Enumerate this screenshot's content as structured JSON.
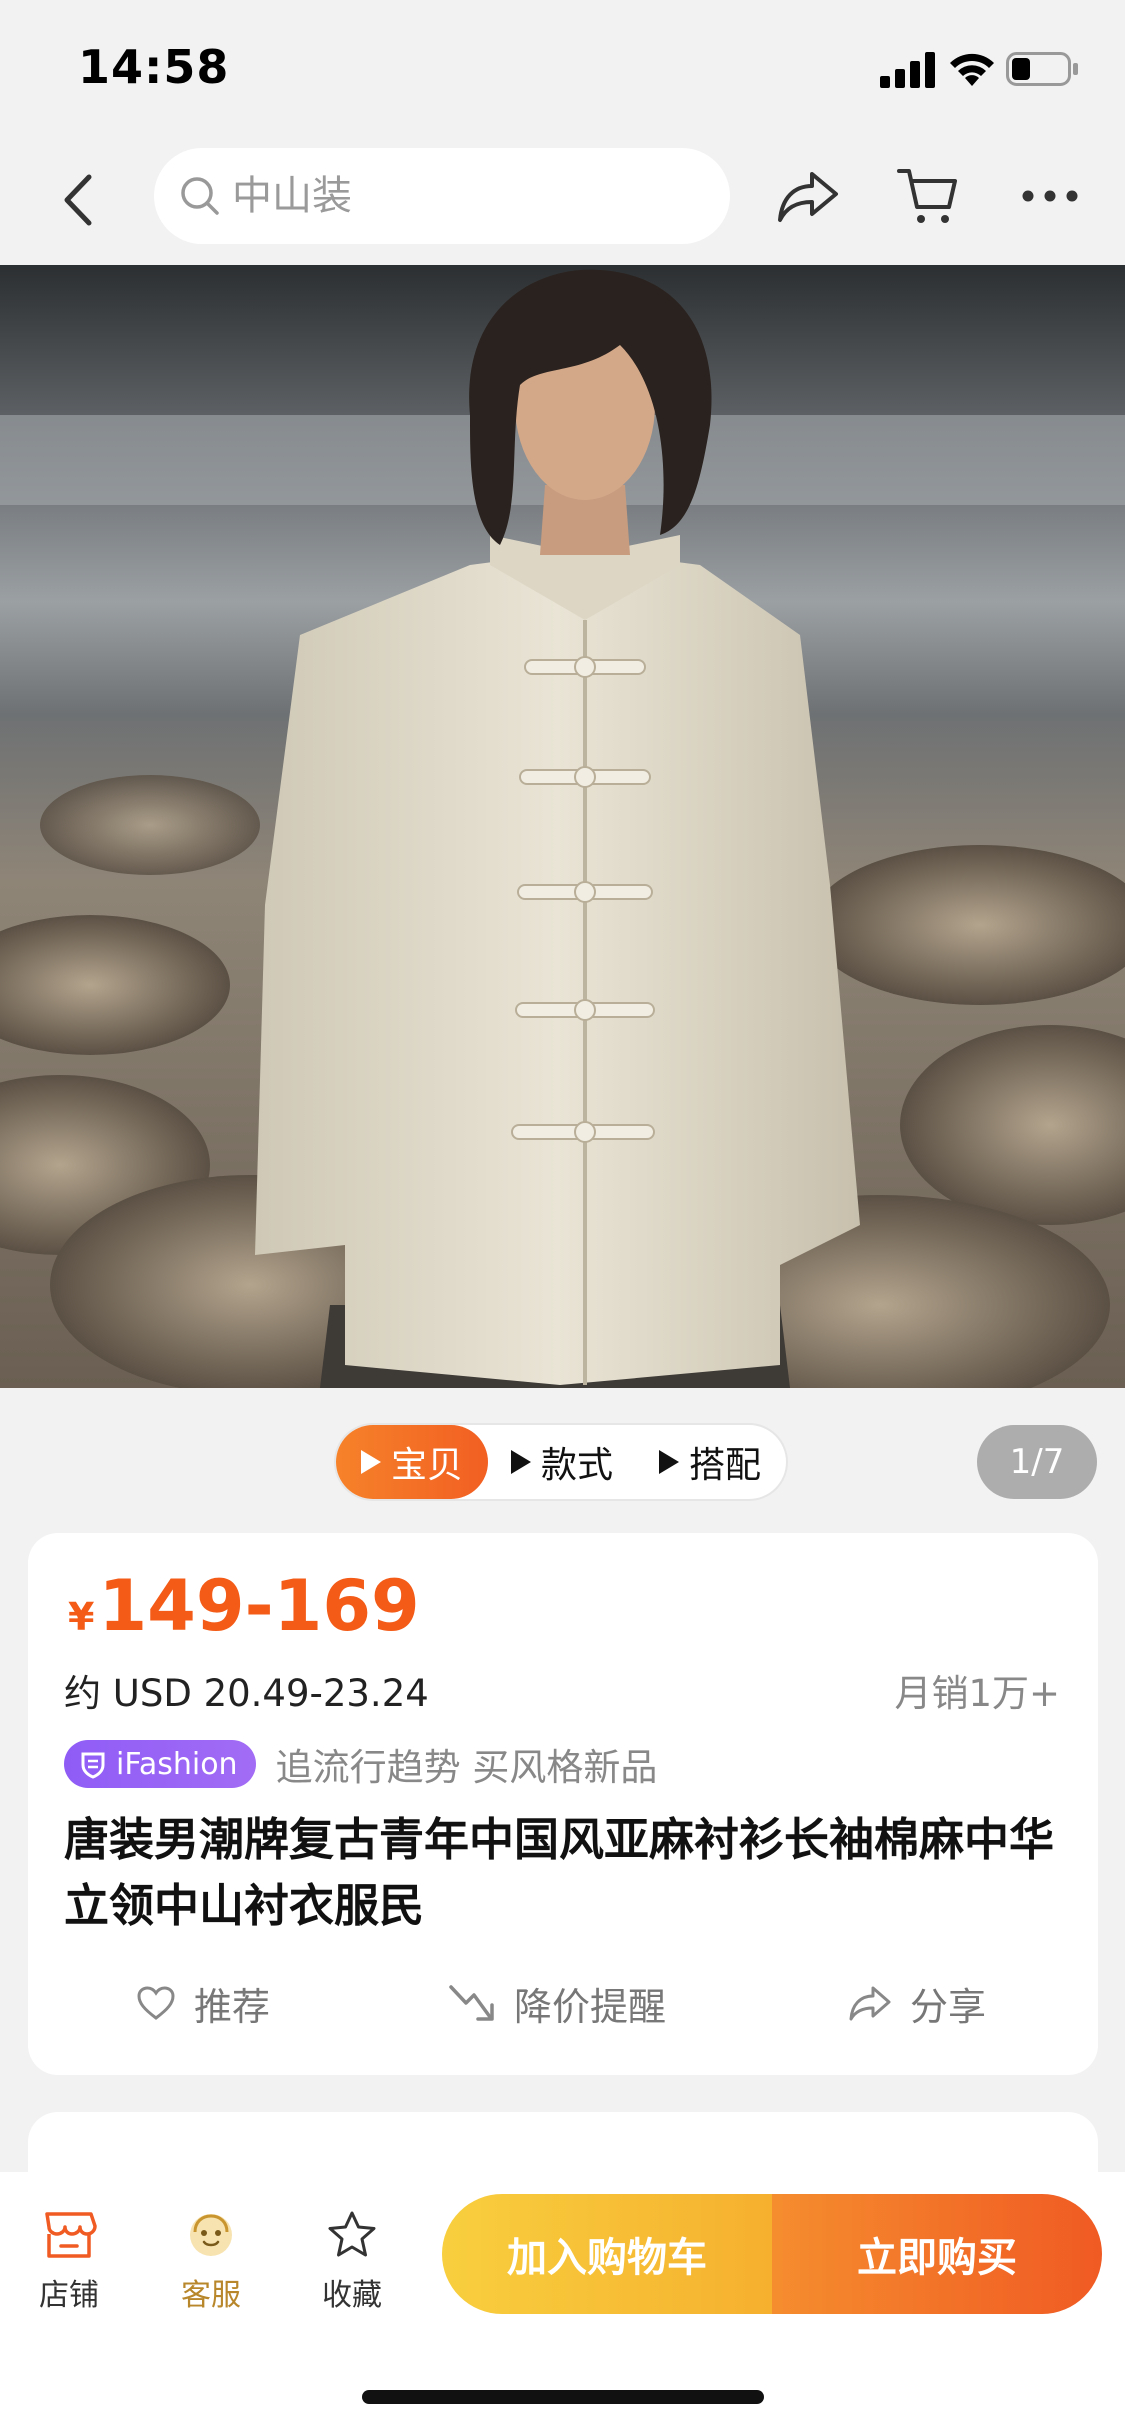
{
  "status_bar": {
    "time": "14:58"
  },
  "nav": {
    "search_placeholder": "中山装",
    "icons": [
      "back-icon",
      "search-icon",
      "share-icon",
      "cart-icon",
      "more-icon"
    ]
  },
  "gallery": {
    "tabs": [
      {
        "label": "宝贝",
        "active": true
      },
      {
        "label": "款式",
        "active": false
      },
      {
        "label": "搭配",
        "active": false
      }
    ],
    "counter": "1/7"
  },
  "product": {
    "currency": "¥",
    "price": "149-169",
    "usd": "约 USD 20.49-23.24",
    "sales": "月销1万+",
    "brand": "iFashion",
    "slogan": "追流行趋势 买风格新品",
    "title": "唐装男潮牌复古青年中国风亚麻衬衫长袖棉麻中华立领中山衬衣服民",
    "actions": {
      "recommend": "推荐",
      "price_alert": "降价提醒",
      "share": "分享"
    }
  },
  "bottom_bar": {
    "store": "店铺",
    "service": "客服",
    "favorite": "收藏",
    "add_to_cart": "加入购物车",
    "buy_now": "立即购买"
  },
  "colors": {
    "accent_orange": "#f35b17",
    "cart_yellow": "#f8cf3e",
    "brand_purple": "#8f5cf6",
    "page_bg": "#f2f2f2"
  }
}
